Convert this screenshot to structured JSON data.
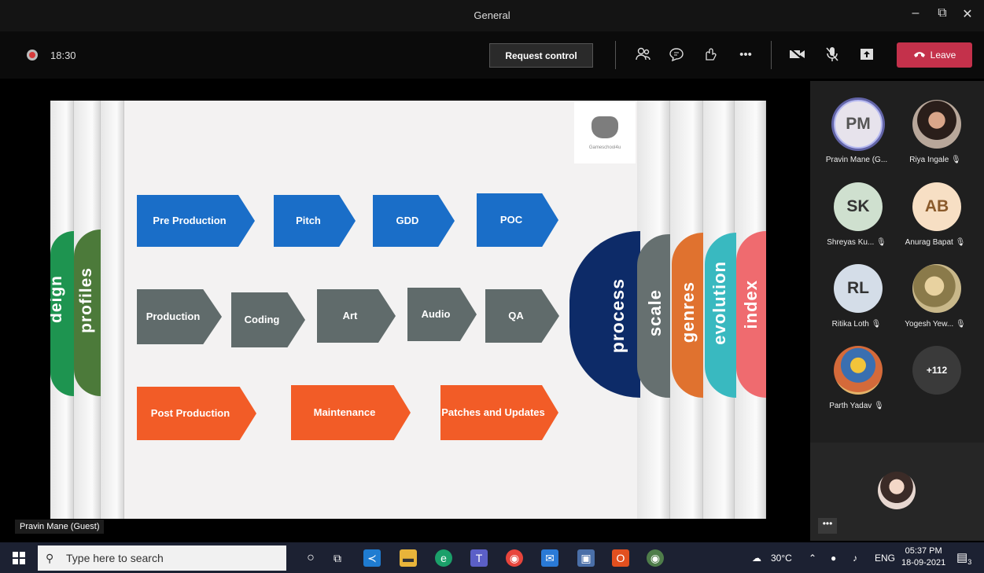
{
  "window": {
    "title": "General",
    "minimize": "–",
    "maximize": "⧉",
    "close": "✕"
  },
  "meeting": {
    "timer": "18:30",
    "request_control": "Request control",
    "leave": "Leave"
  },
  "slide": {
    "left_tabs": [
      "deign",
      "profiles"
    ],
    "right_tabs": [
      "process",
      "scale",
      "genres",
      "evolution",
      "index"
    ],
    "logo_text": "Gameschool4u",
    "row1": [
      "Pre Production",
      "Pitch",
      "GDD",
      "POC"
    ],
    "row2": [
      "Production",
      "Coding",
      "Art",
      "Audio",
      "QA"
    ],
    "row3": [
      "Post Production",
      "Maintenance",
      "Patches and Updates"
    ],
    "colors": {
      "blue": "#1a6ec8",
      "gray": "#606b6b",
      "orange": "#f25c27",
      "navy": "#0d2b68"
    }
  },
  "presenter_label": "Pravin Mane (Guest)",
  "participants": [
    {
      "initials": "PM",
      "name": "Pravin Mane (G..."
    },
    {
      "initials": "",
      "name": "Riya Ingale"
    },
    {
      "initials": "SK",
      "name": "Shreyas Ku..."
    },
    {
      "initials": "AB",
      "name": "Anurag Bapat"
    },
    {
      "initials": "RL",
      "name": "Ritika Loth"
    },
    {
      "initials": "",
      "name": "Yogesh Yew..."
    },
    {
      "initials": "",
      "name": "Parth Yadav"
    },
    {
      "initials": "+112",
      "name": ""
    }
  ],
  "panel_more": "•••",
  "taskbar": {
    "search_placeholder": "Type here to search",
    "weather": "30°C",
    "language": "ENG",
    "time": "05:37 PM",
    "date": "18-09-2021",
    "notification_count": "3"
  }
}
